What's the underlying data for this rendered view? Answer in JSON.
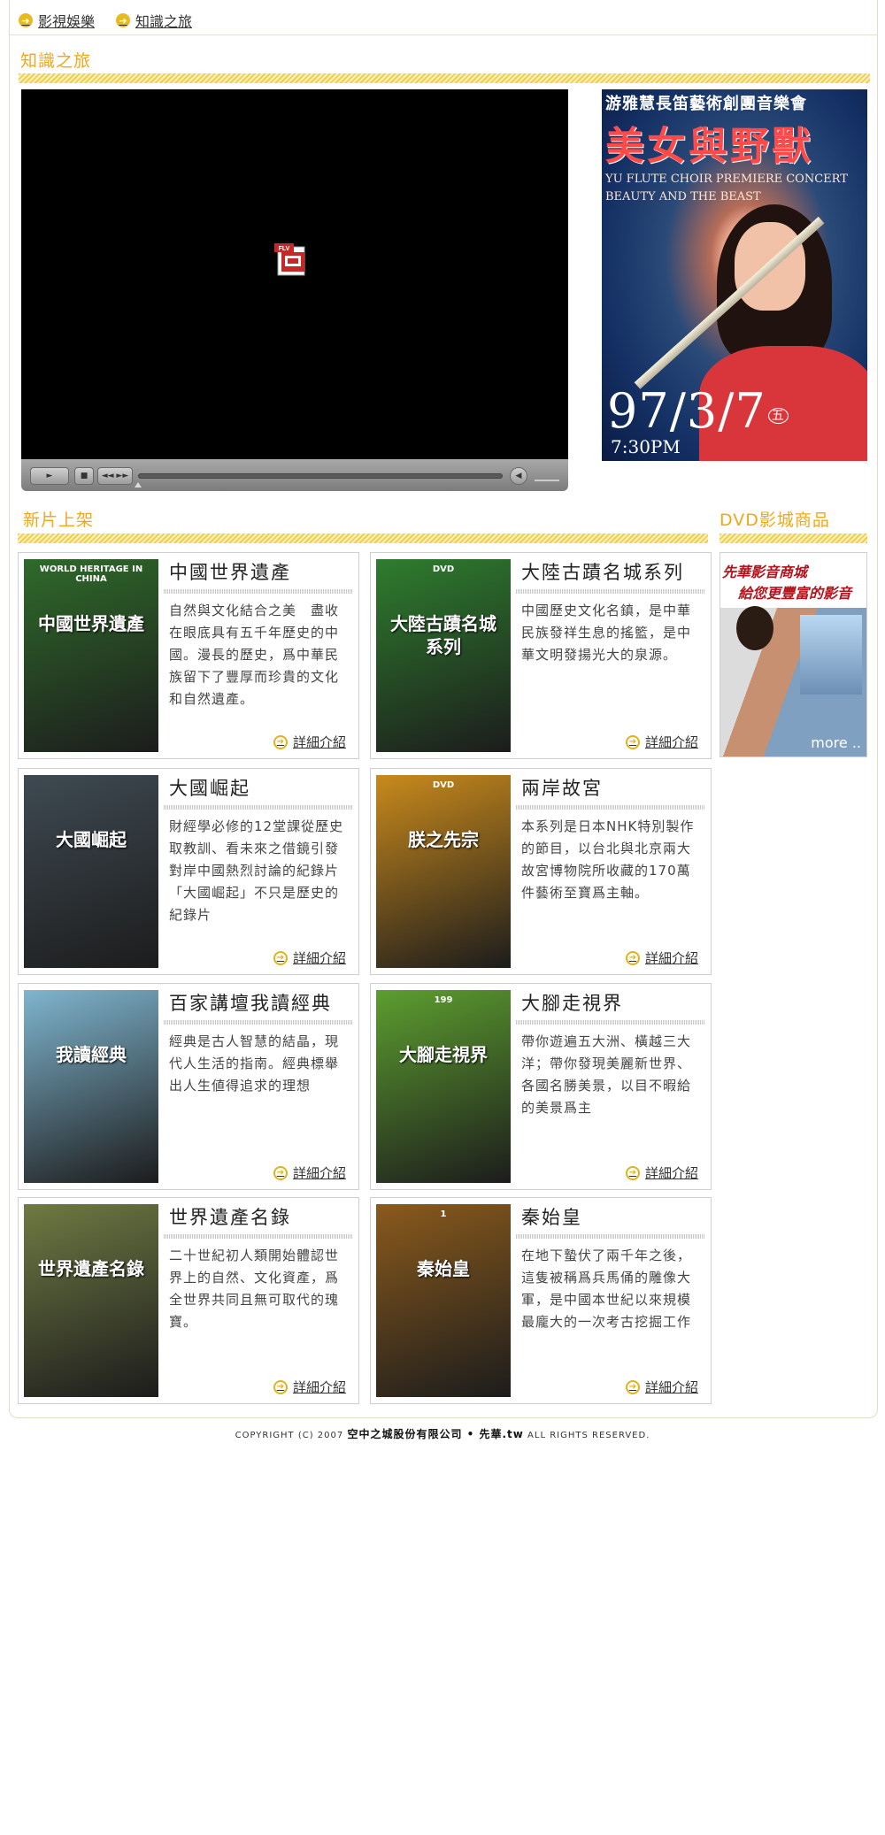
{
  "breadcrumb": [
    "影視娛樂",
    "知識之旅"
  ],
  "section_main_title": "知識之旅",
  "player": {
    "badge": "FLV"
  },
  "poster": {
    "top": "游雅慧長笛藝術創團音樂會",
    "title": "美女與野獸",
    "en_line1": "YU FLUTE CHOIR PREMIERE CONCERT",
    "en_line2": "BEAUTY AND THE BEAST",
    "date": "97/3/7",
    "date_suffix": "五",
    "time": "7:30PM"
  },
  "new_arrivals_title": "新片上架",
  "dvd_title": "DVD影城商品",
  "dvd_box": {
    "line1": "先華影音商城",
    "line2": "給您更豐富的影音",
    "more": "more .."
  },
  "more_label": "詳細介紹",
  "products": [
    {
      "title": "中國世界遺產",
      "desc": "自然與文化結合之美　盡收在眼底具有五千年歷史的中國。漫長的歷史，爲中華民族留下了豐厚而珍貴的文化和自然遺產。",
      "cover_caption": "中國世界遺產",
      "cover_top": "WORLD HERITAGE IN CHINA",
      "cover_bg": "#2f6a2a"
    },
    {
      "title": "大陸古蹟名城系列",
      "desc": "中國歷史文化名鎮，是中華民族發祥生息的搖籃，是中華文明發揚光大的泉源。",
      "cover_caption": "大陸古蹟名城系列",
      "cover_top": "DVD",
      "cover_bg": "#2e7d2e"
    },
    {
      "title": "大國崛起",
      "desc": "財經學必修的12堂課從歷史取教訓、看未來之借鏡引發對岸中國熱烈討論的紀錄片「大國崛起」不只是歷史的紀錄片",
      "cover_caption": "大國崛起",
      "cover_top": "",
      "cover_bg": "#3e4a52"
    },
    {
      "title": "兩岸故宮",
      "desc": "本系列是日本NHK特別製作的節目，以台北與北京兩大故宮博物院所收藏的170萬件藝術至寶爲主軸。",
      "cover_caption": "朕之先宗",
      "cover_top": "DVD",
      "cover_bg": "#c98a1c"
    },
    {
      "title": "百家講壇我讀經典",
      "desc": "經典是古人智慧的結晶，現代人生活的指南。經典標舉出人生値得追求的理想",
      "cover_caption": "我讀經典",
      "cover_top": "",
      "cover_bg": "#7fb5cf"
    },
    {
      "title": "大腳走視界",
      "desc": "帶你遊遍五大洲、橫越三大洋；帶你發現美麗新世界、各國名勝美景，以目不暇給的美景爲主",
      "cover_caption": "大腳走視界",
      "cover_top": "199",
      "cover_bg": "#5c9e2f"
    },
    {
      "title": "世界遺產名錄",
      "desc": " 二十世紀初人類開始體認世界上的自然、文化資產，爲全世界共同且無可取代的瑰寶。",
      "cover_caption": "世界遺產名錄",
      "cover_top": "",
      "cover_bg": "#6e7a42"
    },
    {
      "title": "秦始皇",
      "desc": "在地下蟄伏了兩千年之後，這隻被稱爲兵馬俑的雕像大軍，是中國本世紀以來規模最龐大的一次考古挖掘工作",
      "cover_caption": "秦始皇",
      "cover_top": "1",
      "cover_bg": "#8a5a1c"
    }
  ],
  "footer": {
    "prefix": "COPYRIGHT (C) 2007",
    "company": "空中之城股份有限公司 • 先華.tw",
    "suffix": "ALL RIGHTS RESERVED."
  }
}
